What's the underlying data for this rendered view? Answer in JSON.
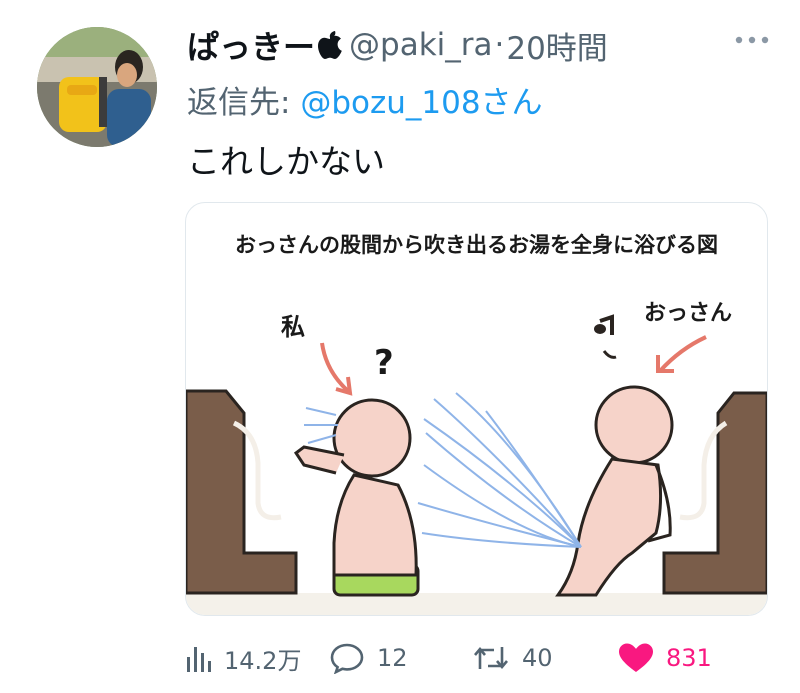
{
  "tweet": {
    "display_name": "ぱっきー",
    "handle": "@paki_ra",
    "separator": "·",
    "time": "20時間",
    "reply_prefix": "返信先:",
    "reply_to": "@bozu_108さん",
    "text": "これしかない"
  },
  "media": {
    "caption": "おっさんの股間から吹き出るお湯を全身に浴びる図",
    "label_me": "私",
    "label_question": "?",
    "label_ossan": "おっさん"
  },
  "actions": {
    "views": "14.2万",
    "replies": "12",
    "retweets": "40",
    "likes": "831"
  },
  "colors": {
    "link": "#1d9bf0",
    "like": "#f91880",
    "muted": "#536471"
  },
  "icons": [
    "apple-icon",
    "more-icon",
    "views-icon",
    "reply-icon",
    "retweet-icon",
    "heart-icon"
  ]
}
